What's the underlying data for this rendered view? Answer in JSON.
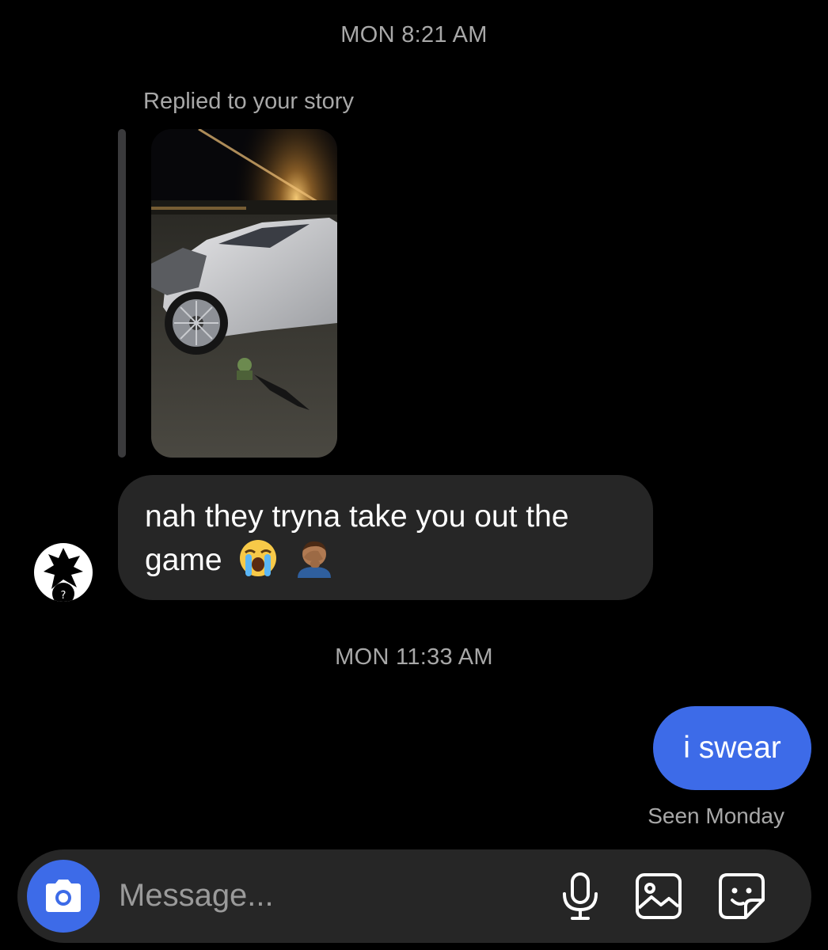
{
  "thread": {
    "timestamp_1": "MON 8:21 AM",
    "reply_label": "Replied to your story",
    "story": {
      "description": "photo of a wrecked white car at night"
    },
    "incoming_message": {
      "text": "nah they tryna take you out the game",
      "emojis": [
        "loudly-crying-face-emoji",
        "person-facepalming-emoji"
      ]
    },
    "timestamp_2": "MON 11:33 AM",
    "outgoing_message": {
      "text": "i swear"
    },
    "seen_status": "Seen Monday"
  },
  "composer": {
    "placeholder": "Message...",
    "icons": [
      "camera-icon",
      "microphone-icon",
      "gallery-icon",
      "sticker-icon"
    ]
  },
  "colors": {
    "background": "#000000",
    "incoming_bubble": "#262626",
    "outgoing_bubble": "#3d6be8",
    "secondary_text": "#a8a8a8"
  }
}
